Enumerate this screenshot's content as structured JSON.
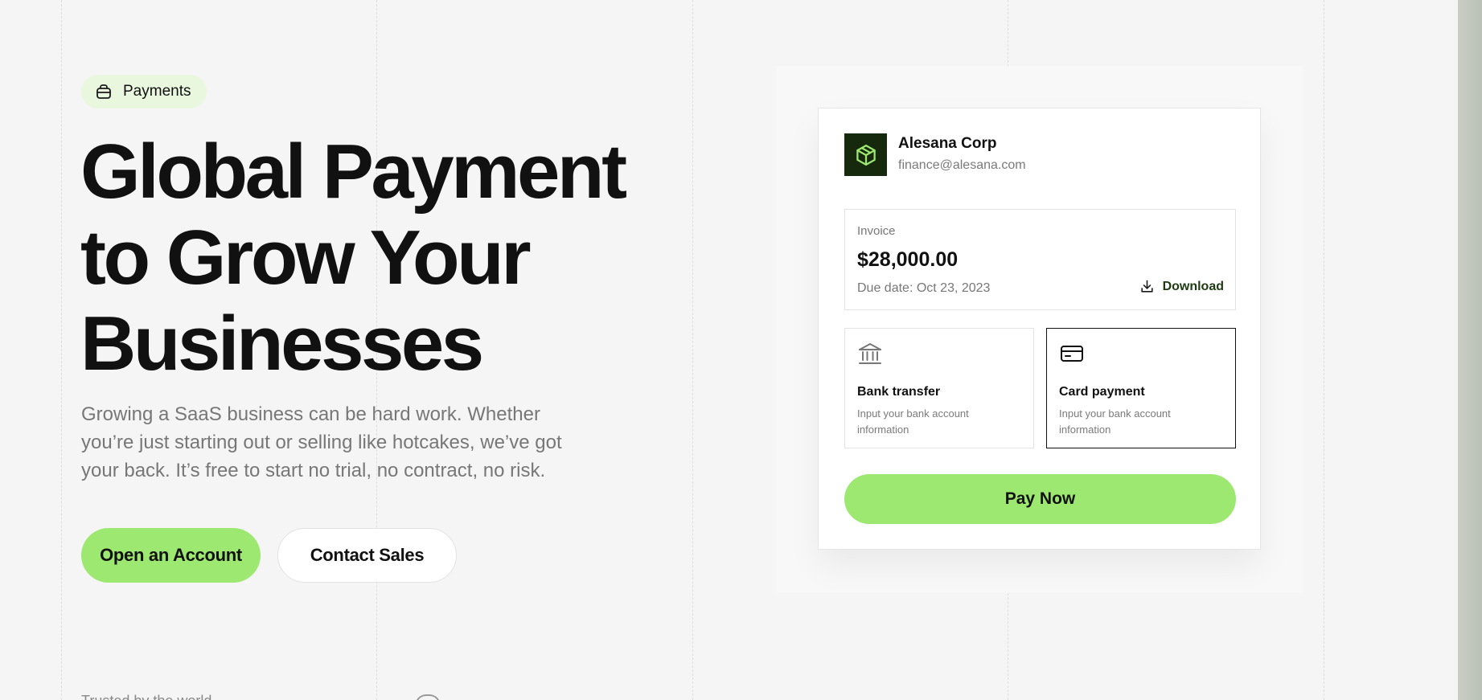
{
  "hero": {
    "badge_label": "Payments",
    "headline_lines": [
      "Global Payment",
      "to Grow Your",
      "Businesses"
    ],
    "subtitle": "Growing a SaaS business can be hard work. Whether you’re just starting out or selling like hotcakes, we’ve got your back. It’s free to start  no trial, no contract, no risk.",
    "primary_cta": "Open an Account",
    "secondary_cta": "Contact Sales",
    "trusted_text": "Trusted by the world..."
  },
  "invoice_card": {
    "company_name": "Alesana Corp",
    "company_email": "finance@alesana.com",
    "invoice_label": "Invoice",
    "amount": "$28,000.00",
    "due_date": "Due date: Oct 23, 2023",
    "download_label": "Download",
    "payment_methods": [
      {
        "title": "Bank transfer",
        "description": "Input your bank account information",
        "icon": "bank-icon",
        "selected": false
      },
      {
        "title": "Card payment",
        "description": "Input your bank account information",
        "icon": "credit-card-icon",
        "selected": true
      }
    ],
    "pay_button": "Pay Now"
  },
  "colors": {
    "accent": "#9de870",
    "badge_bg": "#e9f7df",
    "logo_bg": "#17290c",
    "page_bg": "#f5f5f5"
  }
}
